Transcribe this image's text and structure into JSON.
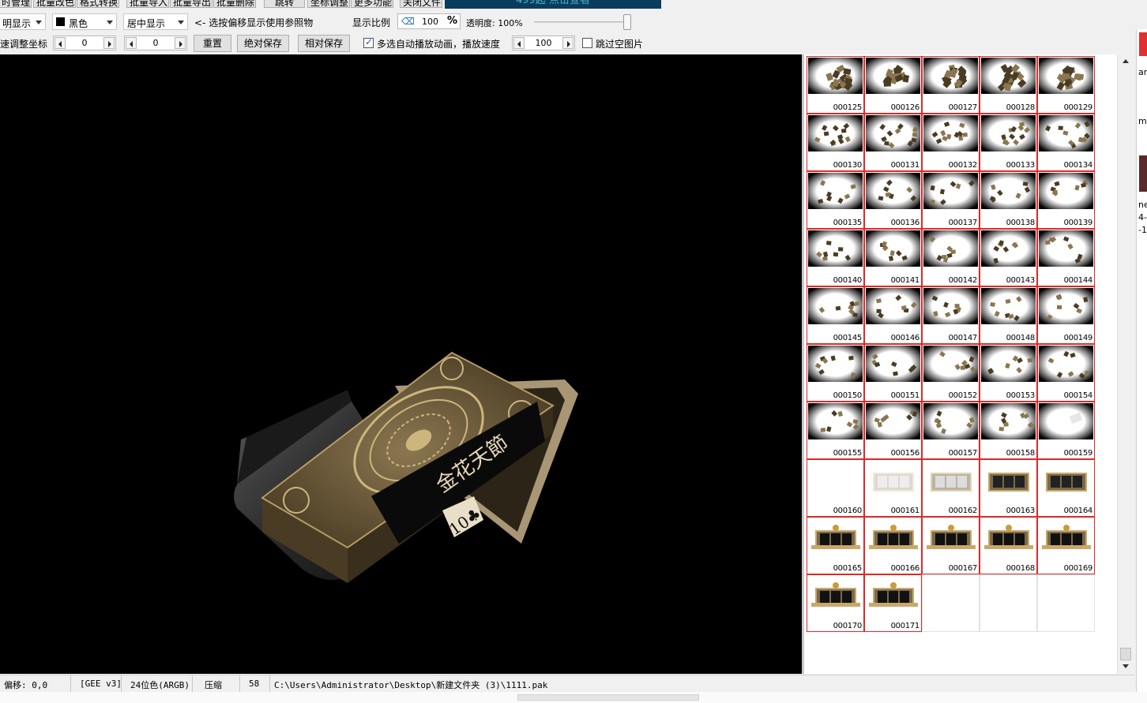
{
  "menu": {
    "items": [
      "时管理",
      "批量改色",
      "格式转换",
      "批量导入",
      "批量导出",
      "批量删除",
      "跳转",
      "坐标调整",
      "更多功能",
      "关闭文件"
    ],
    "banner_text": "499起 点击查看"
  },
  "toolbar1": {
    "display_mode": "明显示",
    "bg_color": "黑色",
    "align_mode": "居中显示",
    "offset_hint": "<- 选按偏移显示使用参照物",
    "ratio_label": "显示比例",
    "ratio_value": "100",
    "ratio_unit": "%",
    "opacity_label": "透明度: 100%"
  },
  "toolbar2": {
    "coord_label": "速调整坐标",
    "x_value": "0",
    "y_value": "0",
    "reset_label": "重置",
    "abs_save_label": "绝对保存",
    "rel_save_label": "相对保存",
    "autoplay_label": "多选自动播放动画，播放速度",
    "autoplay_checked": true,
    "speed_value": "100",
    "skip_empty_label": "跳过空图片",
    "skip_empty_checked": false
  },
  "canvas": {
    "background": "#000000",
    "box_text": "金花天節",
    "card_text": "10♣"
  },
  "thumbnails": [
    {
      "label": "000125",
      "kind": "cards-dense",
      "selected": true
    },
    {
      "label": "000126",
      "kind": "cards-dense",
      "selected": true
    },
    {
      "label": "000127",
      "kind": "cards-dense",
      "selected": true
    },
    {
      "label": "000128",
      "kind": "cards-dense",
      "selected": true
    },
    {
      "label": "000129",
      "kind": "cards-dense",
      "selected": true
    },
    {
      "label": "000130",
      "kind": "cards-mid",
      "selected": true
    },
    {
      "label": "000131",
      "kind": "cards-mid",
      "selected": true
    },
    {
      "label": "000132",
      "kind": "cards-mid",
      "selected": true
    },
    {
      "label": "000133",
      "kind": "cards-mid",
      "selected": true
    },
    {
      "label": "000134",
      "kind": "cards-mid",
      "selected": true
    },
    {
      "label": "000135",
      "kind": "cards-sparse",
      "selected": true
    },
    {
      "label": "000136",
      "kind": "cards-sparse",
      "selected": true
    },
    {
      "label": "000137",
      "kind": "cards-sparse",
      "selected": true
    },
    {
      "label": "000138",
      "kind": "cards-sparse",
      "selected": true
    },
    {
      "label": "000139",
      "kind": "cards-sparse",
      "selected": true
    },
    {
      "label": "000140",
      "kind": "cards-sparse",
      "selected": true
    },
    {
      "label": "000141",
      "kind": "cards-sparse",
      "selected": true
    },
    {
      "label": "000142",
      "kind": "cards-sparse",
      "selected": true
    },
    {
      "label": "000143",
      "kind": "cards-sparse",
      "selected": true
    },
    {
      "label": "000144",
      "kind": "cards-sparse",
      "selected": true
    },
    {
      "label": "000145",
      "kind": "cards-sparse",
      "selected": true
    },
    {
      "label": "000146",
      "kind": "cards-sparse",
      "selected": true
    },
    {
      "label": "000147",
      "kind": "cards-sparse",
      "selected": true
    },
    {
      "label": "000148",
      "kind": "cards-sparse",
      "selected": true
    },
    {
      "label": "000149",
      "kind": "cards-sparse",
      "selected": true
    },
    {
      "label": "000150",
      "kind": "cards-sparse",
      "selected": true
    },
    {
      "label": "000151",
      "kind": "cards-sparse",
      "selected": true
    },
    {
      "label": "000152",
      "kind": "cards-sparse",
      "selected": true
    },
    {
      "label": "000153",
      "kind": "cards-sparse",
      "selected": true
    },
    {
      "label": "000154",
      "kind": "cards-sparse",
      "selected": true
    },
    {
      "label": "000155",
      "kind": "cards-sparse",
      "selected": true
    },
    {
      "label": "000156",
      "kind": "cards-sparse",
      "selected": true
    },
    {
      "label": "000157",
      "kind": "cards-sparse",
      "selected": true
    },
    {
      "label": "000158",
      "kind": "cards-sparse",
      "selected": true
    },
    {
      "label": "000159",
      "kind": "fade",
      "selected": true
    },
    {
      "label": "000160",
      "kind": "empty",
      "selected": true
    },
    {
      "label": "000161",
      "kind": "frame-faint",
      "selected": true
    },
    {
      "label": "000162",
      "kind": "frame-light",
      "selected": true
    },
    {
      "label": "000163",
      "kind": "frame",
      "selected": true
    },
    {
      "label": "000164",
      "kind": "frame",
      "selected": true
    },
    {
      "label": "000165",
      "kind": "frame-full",
      "selected": true
    },
    {
      "label": "000166",
      "kind": "frame-full",
      "selected": true
    },
    {
      "label": "000167",
      "kind": "frame-full",
      "selected": true
    },
    {
      "label": "000168",
      "kind": "frame-full",
      "selected": true
    },
    {
      "label": "000169",
      "kind": "frame-full",
      "selected": true
    },
    {
      "label": "000170",
      "kind": "frame-full",
      "selected": true
    },
    {
      "label": "000171",
      "kind": "frame-full",
      "selected": true
    },
    {
      "label": "",
      "kind": "blank",
      "selected": false
    },
    {
      "label": "",
      "kind": "blank",
      "selected": false
    },
    {
      "label": "",
      "kind": "blank",
      "selected": false
    }
  ],
  "status": {
    "offset": "偏移: 0,0",
    "format": "[GEE v3]",
    "color_depth": "24位色(ARGB)",
    "compression": "压缩",
    "count": "58",
    "path": "C:\\Users\\Administrator\\Desktop\\新建文件夹 (3)\\1111.pak"
  },
  "edge_texts": [
    "ar",
    "m",
    "ne",
    "4-",
    "-1"
  ]
}
